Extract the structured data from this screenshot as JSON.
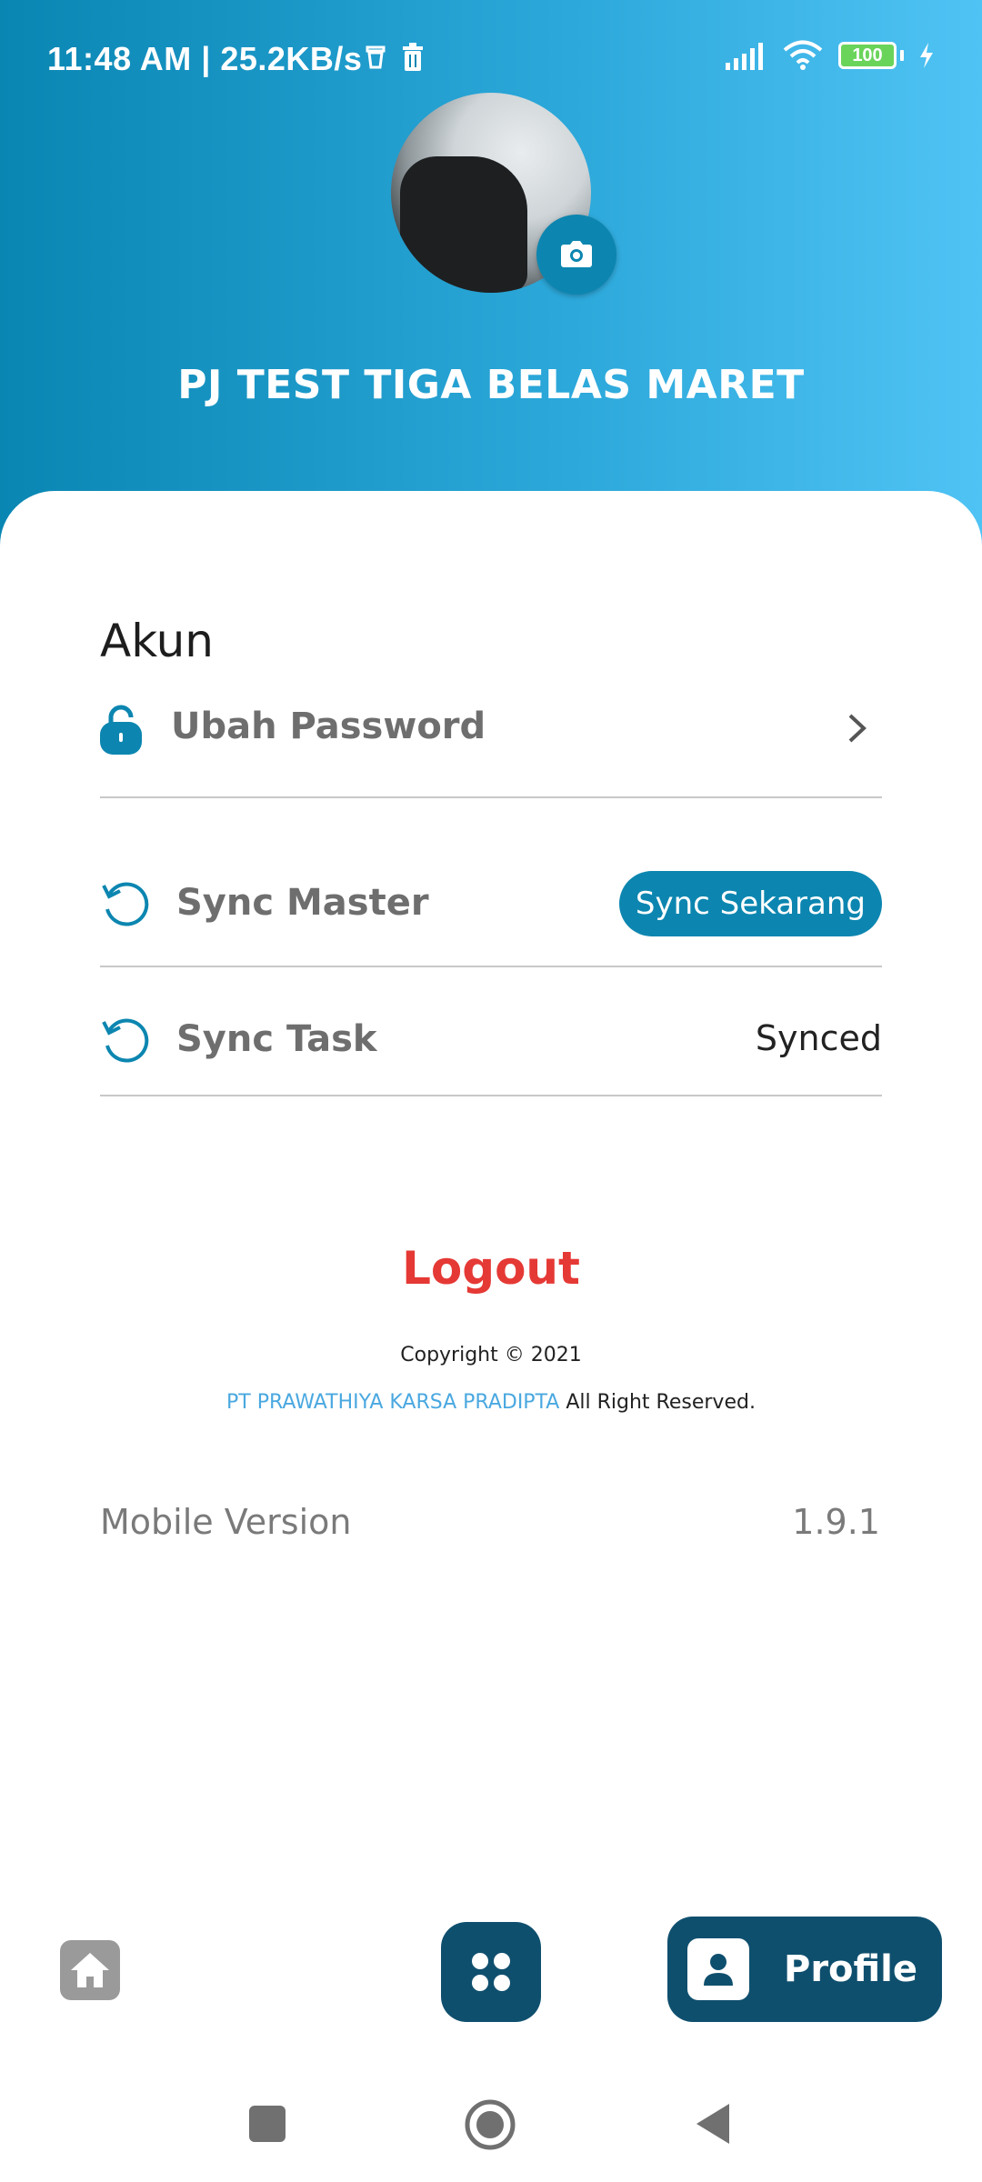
{
  "status_bar": {
    "time": "11:48 AM | 25.2KB/s",
    "battery_level": "100"
  },
  "profile": {
    "name": "PJ TEST TIGA BELAS MARET"
  },
  "account_section": {
    "title": "Akun",
    "change_password_label": "Ubah Password"
  },
  "sync": {
    "master_label": "Sync Master",
    "master_button_label": "Sync Sekarang",
    "task_label": "Sync Task",
    "task_status": "Synced"
  },
  "logout_label": "Logout",
  "footer": {
    "copyright": "Copyright © 2021",
    "company": "PT PRAWATHIYA KARSA PRADIPTA",
    "rights": "All Right Reserved."
  },
  "version": {
    "label": "Mobile Version",
    "value": "1.9.1"
  },
  "bottom_nav": {
    "profile_label": "Profile"
  },
  "colors": {
    "accent": "#0c86b0",
    "nav_dark": "#0f4f6e",
    "logout": "#e53935",
    "company_link": "#4aa8e0"
  },
  "icons": {
    "camera": "camera-icon",
    "lock": "lock-icon",
    "chevron": "chevron-right-icon",
    "sync": "sync-icon",
    "home": "home-icon",
    "apps": "apps-grid-icon",
    "profile": "person-icon"
  }
}
